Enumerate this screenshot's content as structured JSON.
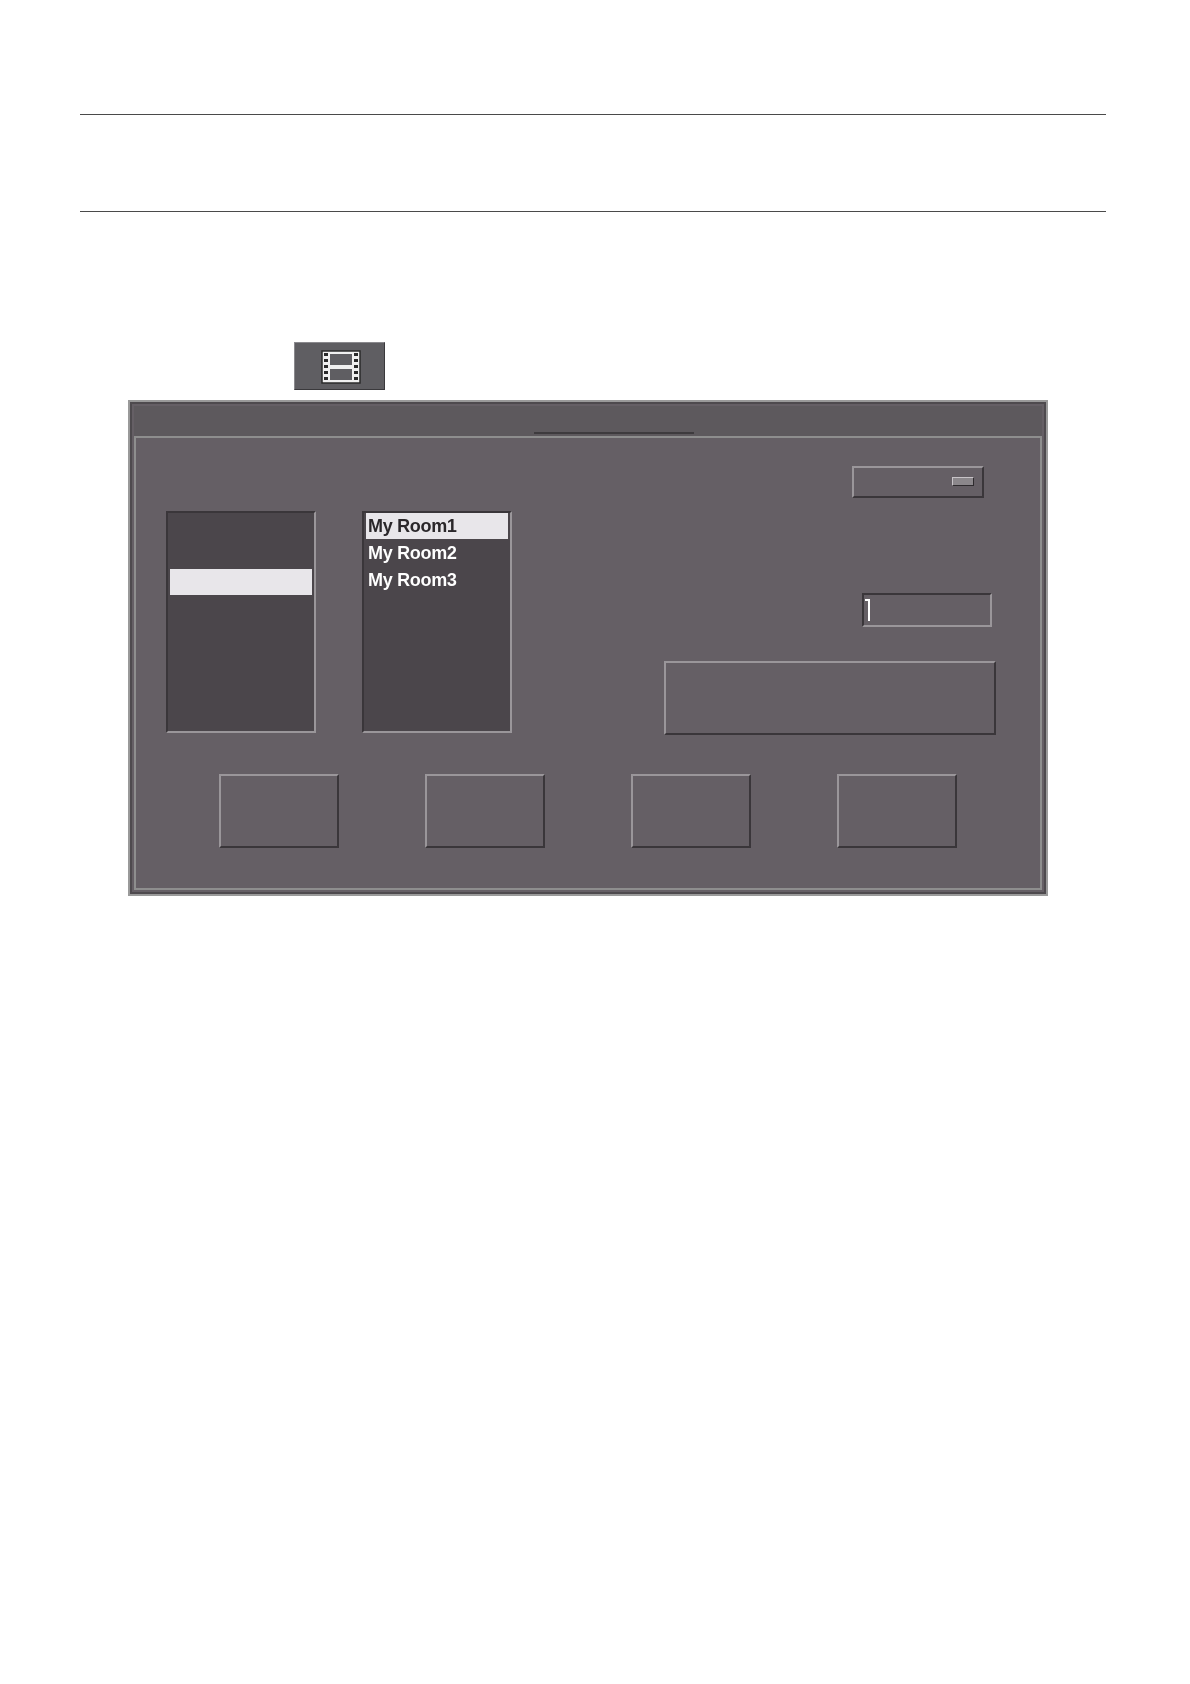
{
  "rooms_list": {
    "items": [
      {
        "label": "My Room1",
        "selected": true
      },
      {
        "label": "My Room2",
        "selected": false
      },
      {
        "label": "My Room3",
        "selected": false
      }
    ]
  },
  "icons": {
    "toolbar_button": "film-strip-icon"
  },
  "colors": {
    "dialog_background": "#655f65",
    "list_background": "#4b464b",
    "selection_highlight": "#e8e6ea",
    "list_text": "#ffffff"
  }
}
